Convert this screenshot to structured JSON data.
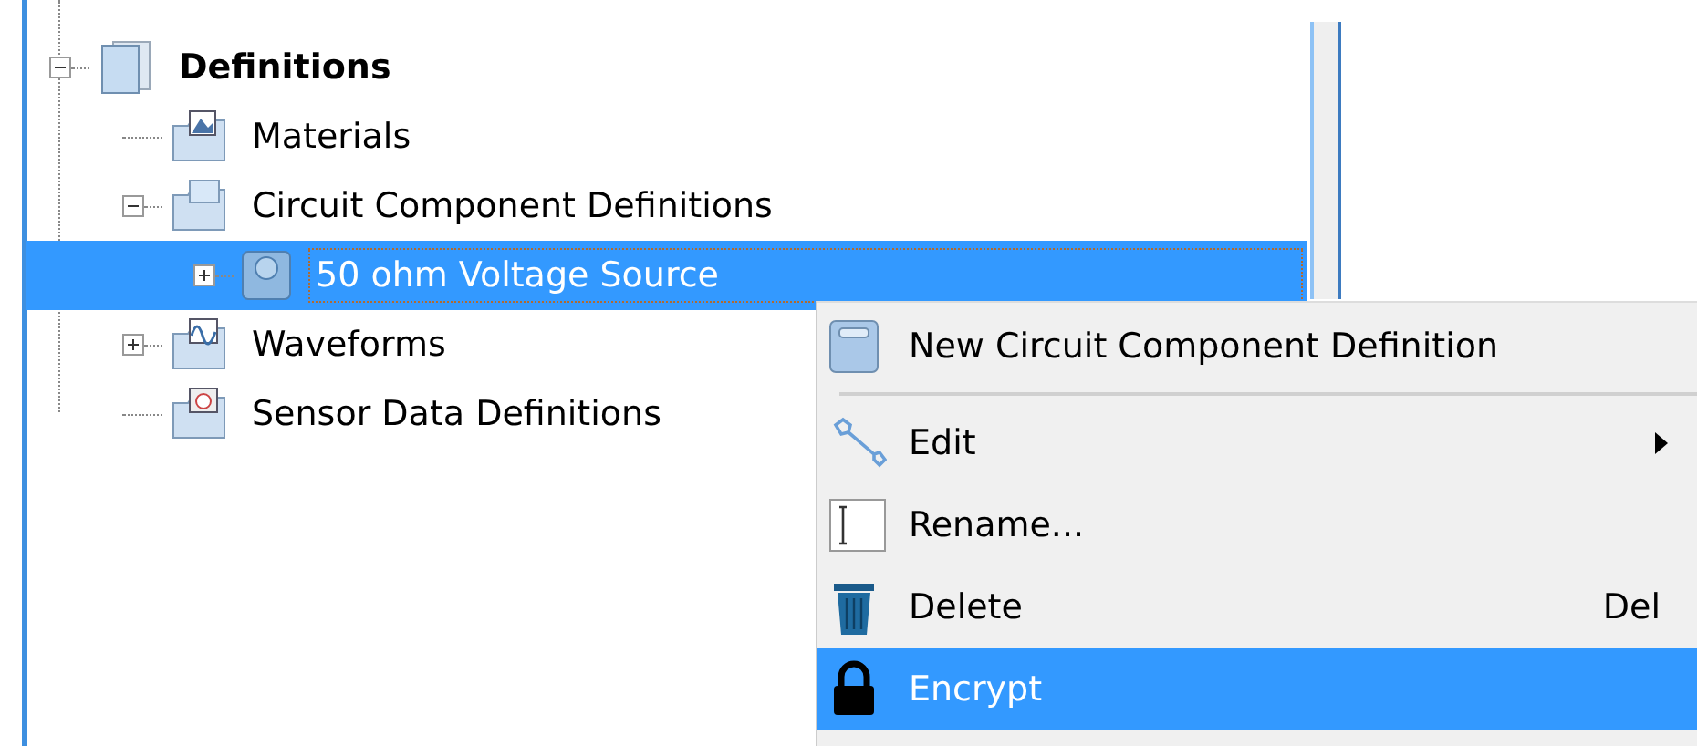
{
  "tree": [
    {
      "label": "Definitions",
      "expanded": true,
      "selected": false,
      "children": [
        {
          "label": "Materials",
          "selected": false
        },
        {
          "label": "Circuit Component Definitions",
          "expanded": true,
          "selected": false,
          "children": [
            {
              "label": "50 ohm Voltage Source",
              "expanded": false,
              "selected": true
            }
          ]
        },
        {
          "label": "Waveforms",
          "expanded": false,
          "selected": false
        },
        {
          "label": "Sensor Data Definitions",
          "selected": false
        }
      ]
    }
  ],
  "context_menu": [
    {
      "kind": "item",
      "label": "New Circuit Component Definition",
      "selected": false
    },
    {
      "kind": "separator"
    },
    {
      "kind": "item",
      "label": "Edit",
      "has_submenu": true,
      "selected": false
    },
    {
      "kind": "item",
      "label": "Rename...",
      "selected": false
    },
    {
      "kind": "item",
      "label": "Delete",
      "shortcut": "Del",
      "selected": false
    },
    {
      "kind": "item",
      "label": "Encrypt",
      "selected": true
    }
  ]
}
